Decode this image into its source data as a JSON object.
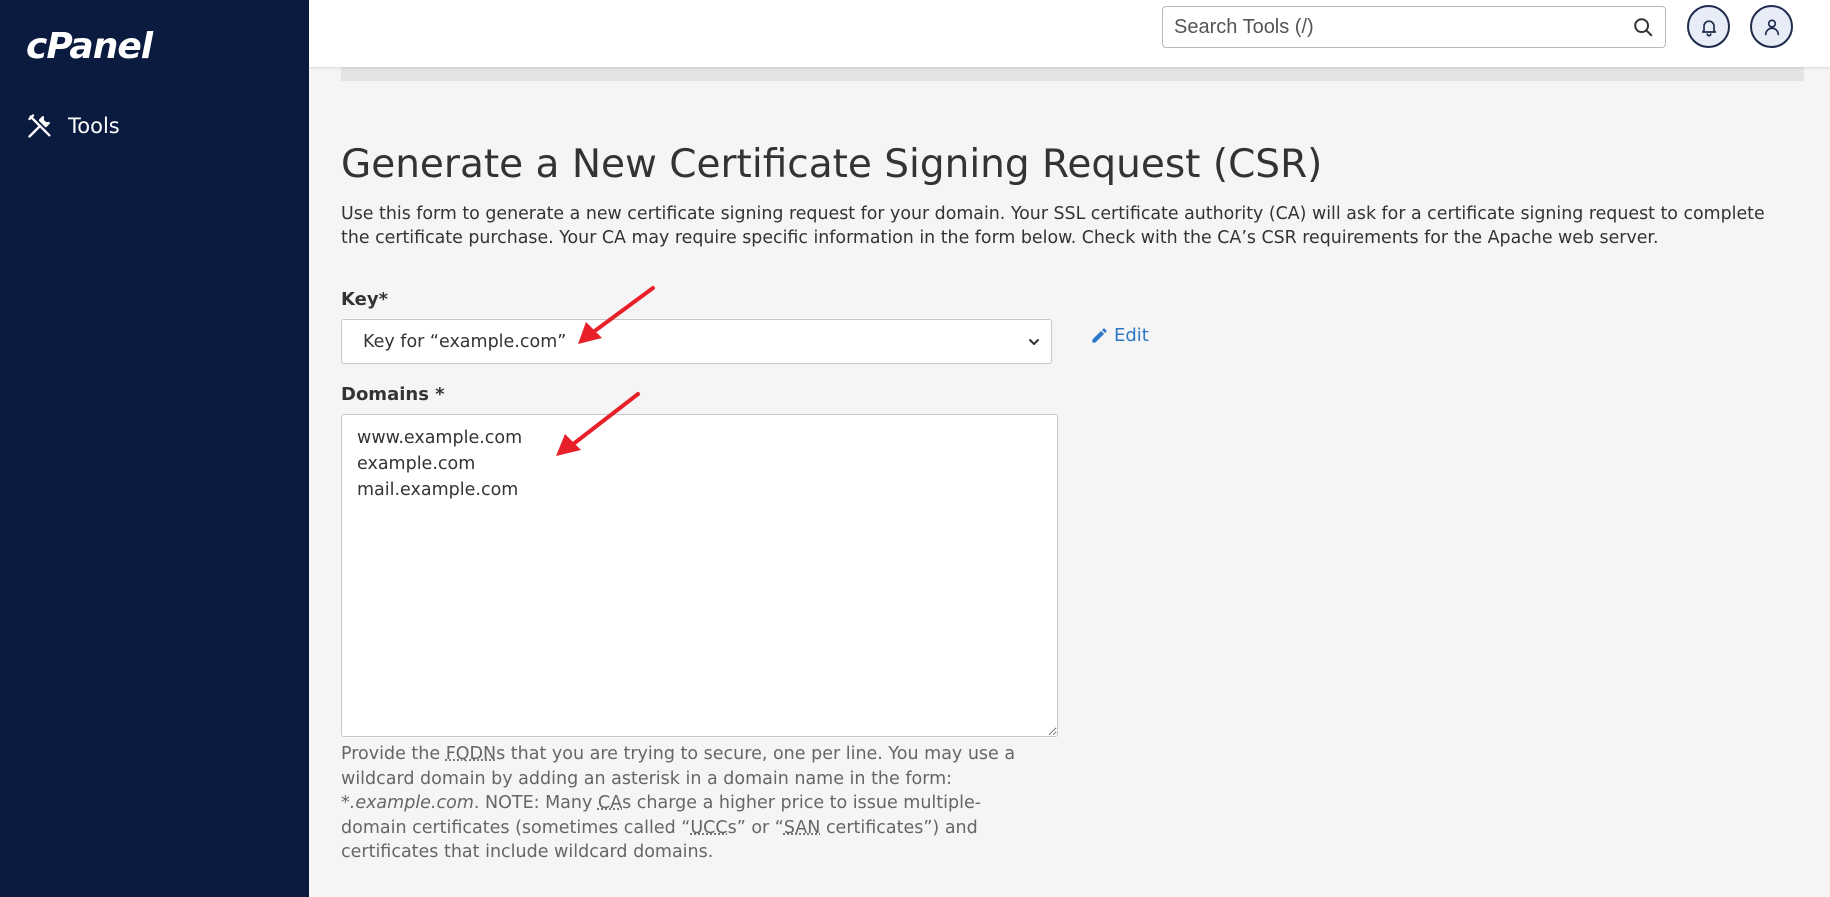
{
  "sidebar": {
    "logo": "cPanel",
    "items": [
      {
        "label": "Tools",
        "icon": "tools-icon"
      }
    ]
  },
  "topbar": {
    "search_placeholder": "Search Tools (/)",
    "icons": [
      "search-icon",
      "bell-icon",
      "user-icon"
    ]
  },
  "page": {
    "title": "Generate a New Certificate Signing Request (CSR)",
    "description": "Use this form to generate a new certificate signing request for your domain. Your SSL certificate authority (CA) will ask for a certificate signing request to complete the certificate purchase. Your CA may require specific information in the form below. Check with the CA’s CSR requirements for the Apache web server."
  },
  "form": {
    "key_label": "Key*",
    "key_value": "Key for “example.com”",
    "edit_label": "Edit",
    "domains_label": "Domains *",
    "domains_value": "www.example.com\nexample.com\nmail.example.com",
    "help": {
      "p1": "Provide the ",
      "fqdn": "FQDN",
      "p2": "s that you are trying to secure, one per line. You may use a wildcard domain by adding an asterisk in a domain name in the form: ",
      "wildcard": "*.example.com",
      "p3": ". NOTE: Many ",
      "ca": "CA",
      "p4": "s charge a higher price to issue multiple-domain certificates (sometimes called “",
      "ucc": "UCC",
      "p5": "s” or “",
      "san": "SAN",
      "p6": " certificates”) and certificates that include wildcard domains."
    }
  },
  "colors": {
    "sidebar_bg": "#0b1b3f",
    "link": "#2a78c6",
    "annotation_arrow": "#e8202a"
  }
}
